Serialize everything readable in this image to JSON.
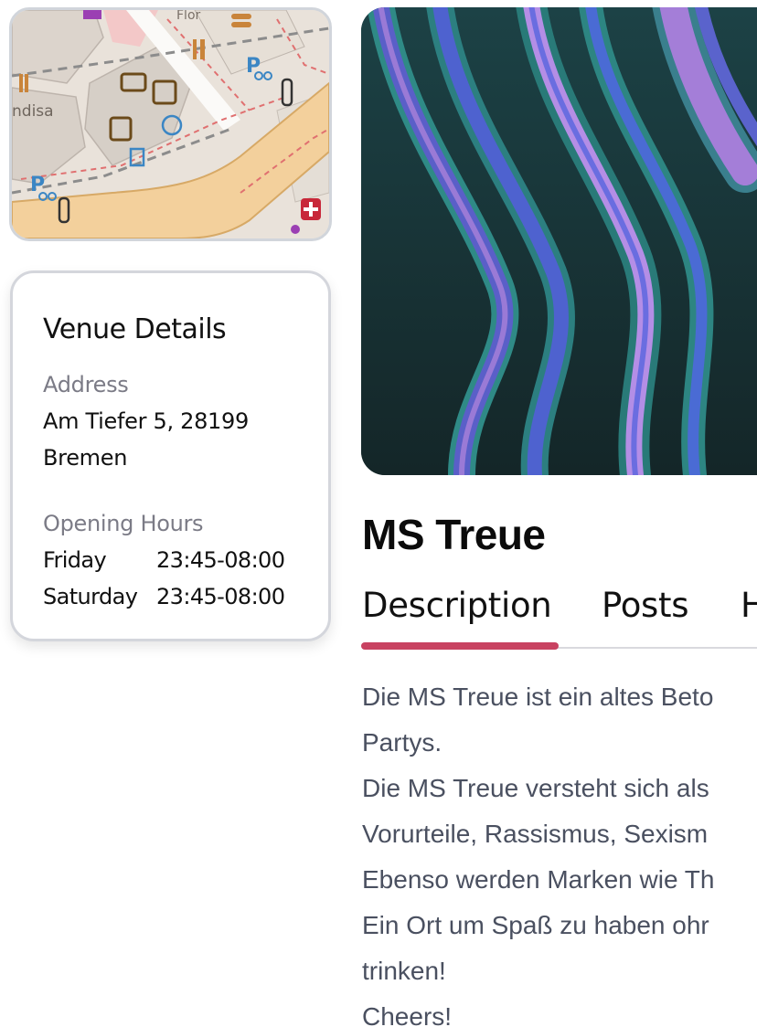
{
  "map": {
    "labels": [
      "Flor",
      "ndisa"
    ]
  },
  "venue_details": {
    "title": "Venue Details",
    "address_label": "Address",
    "address_line1": "Am Tiefer 5, 28199",
    "address_line2": "Bremen",
    "hours_label": "Opening Hours",
    "hours": [
      {
        "day": "Friday",
        "time": "23:45-08:00"
      },
      {
        "day": "Saturday",
        "time": "23:45-08:00"
      }
    ]
  },
  "venue": {
    "name": "MS Treue"
  },
  "tabs": [
    {
      "label": "Description",
      "active": true
    },
    {
      "label": "Posts",
      "active": false
    },
    {
      "label": "H",
      "active": false
    }
  ],
  "description": {
    "lines": [
      "Die MS Treue ist ein altes Beto",
      "Partys.",
      "Die MS Treue versteht sich als",
      "Vorurteile, Rassismus, Sexism",
      "Ebenso werden Marken wie Th",
      "Ein Ort um Spaß zu haben ohr",
      "trinken!",
      "Cheers!"
    ]
  },
  "colors": {
    "accent": "#c84261",
    "muted_text": "#7b7b86",
    "body_text": "#4a5060"
  }
}
